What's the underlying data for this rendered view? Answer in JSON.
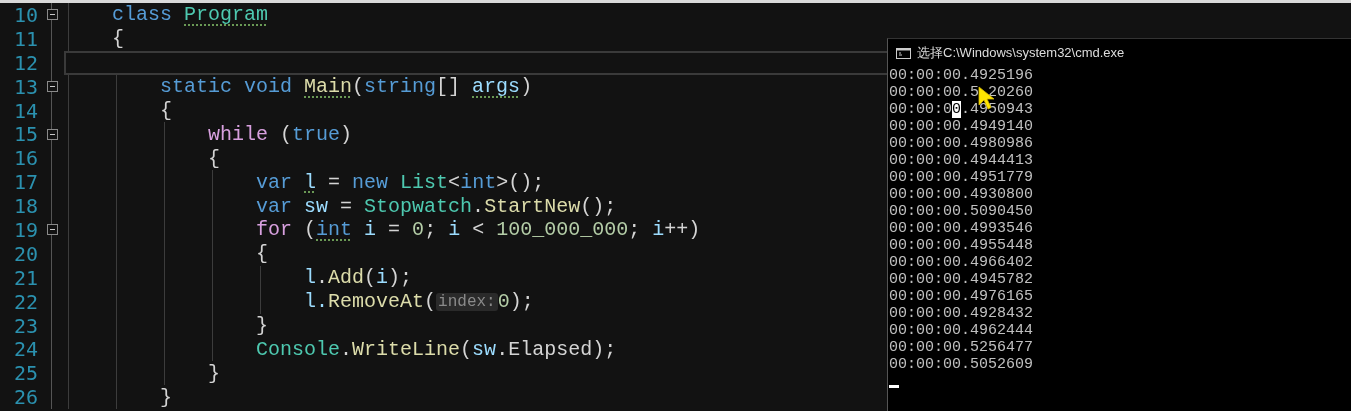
{
  "editor": {
    "lines": [
      {
        "number": "10",
        "current": false,
        "expanded": true,
        "tokens": [
          {
            "text": "    class ",
            "kind": "keyword"
          },
          {
            "text": "Program",
            "kind": "type",
            "underline": true
          }
        ]
      },
      {
        "number": "11",
        "current": false,
        "tokens": [
          {
            "text": "    {",
            "kind": "plain"
          }
        ]
      },
      {
        "number": "12",
        "current": true
      },
      {
        "number": "13",
        "current": false,
        "expanded": true,
        "tokens": [
          {
            "text": "        static void ",
            "kind": "keyword"
          },
          {
            "text": "Main",
            "kind": "method",
            "underline": true
          },
          {
            "text": "(",
            "kind": "plain"
          },
          {
            "text": "string",
            "kind": "keyword"
          },
          {
            "text": "[] ",
            "kind": "plain"
          },
          {
            "text": "args",
            "kind": "local",
            "underline": true
          },
          {
            "text": ")",
            "kind": "plain"
          }
        ]
      },
      {
        "number": "14",
        "current": false,
        "tokens": [
          {
            "text": "        {",
            "kind": "plain"
          }
        ]
      },
      {
        "number": "15",
        "current": false,
        "expanded": true,
        "tokens": [
          {
            "text": "            while",
            "kind": "control"
          },
          {
            "text": " (",
            "kind": "plain"
          },
          {
            "text": "true",
            "kind": "keyword"
          },
          {
            "text": ")",
            "kind": "plain"
          }
        ]
      },
      {
        "number": "16",
        "current": false,
        "tokens": [
          {
            "text": "            {",
            "kind": "plain"
          }
        ]
      },
      {
        "number": "17",
        "current": false,
        "tokens": [
          {
            "text": "                var ",
            "kind": "keyword"
          },
          {
            "text": "l",
            "kind": "local",
            "underline": true
          },
          {
            "text": " = ",
            "kind": "plain"
          },
          {
            "text": "new ",
            "kind": "keyword"
          },
          {
            "text": "List",
            "kind": "type"
          },
          {
            "text": "<",
            "kind": "plain"
          },
          {
            "text": "int",
            "kind": "keyword"
          },
          {
            "text": ">();",
            "kind": "plain"
          }
        ]
      },
      {
        "number": "18",
        "current": false,
        "tokens": [
          {
            "text": "                var ",
            "kind": "keyword"
          },
          {
            "text": "sw",
            "kind": "local"
          },
          {
            "text": " = ",
            "kind": "plain"
          },
          {
            "text": "Stopwatch",
            "kind": "type"
          },
          {
            "text": ".",
            "kind": "plain"
          },
          {
            "text": "StartNew",
            "kind": "method"
          },
          {
            "text": "();",
            "kind": "plain"
          }
        ]
      },
      {
        "number": "19",
        "current": false,
        "expanded": true,
        "tokens": [
          {
            "text": "                for",
            "kind": "control"
          },
          {
            "text": " (",
            "kind": "plain"
          },
          {
            "text": "int",
            "kind": "keyword",
            "underline": true
          },
          {
            "text": " i",
            "kind": "local"
          },
          {
            "text": " = ",
            "kind": "plain"
          },
          {
            "text": "0",
            "kind": "number"
          },
          {
            "text": "; ",
            "kind": "plain"
          },
          {
            "text": "i",
            "kind": "local"
          },
          {
            "text": " < ",
            "kind": "plain"
          },
          {
            "text": "100_000_000",
            "kind": "number"
          },
          {
            "text": "; ",
            "kind": "plain"
          },
          {
            "text": "i",
            "kind": "local"
          },
          {
            "text": "++)",
            "kind": "plain"
          }
        ]
      },
      {
        "number": "20",
        "current": false,
        "tokens": [
          {
            "text": "                {",
            "kind": "plain"
          }
        ]
      },
      {
        "number": "21",
        "current": false,
        "tokens": [
          {
            "text": "                    l",
            "kind": "local"
          },
          {
            "text": ".",
            "kind": "plain"
          },
          {
            "text": "Add",
            "kind": "method"
          },
          {
            "text": "(",
            "kind": "plain"
          },
          {
            "text": "i",
            "kind": "local"
          },
          {
            "text": ");",
            "kind": "plain"
          }
        ]
      },
      {
        "number": "22",
        "current": false,
        "tokens": [
          {
            "text": "                    l.",
            "kind": "local"
          },
          {
            "text": "RemoveAt",
            "kind": "method"
          },
          {
            "text": "(",
            "kind": "plain"
          },
          {
            "text": "index:",
            "kind": "hint"
          },
          {
            "text": "0",
            "kind": "number"
          },
          {
            "text": ");",
            "kind": "plain"
          }
        ]
      },
      {
        "number": "23",
        "current": false,
        "tokens": [
          {
            "text": "                }",
            "kind": "plain"
          }
        ]
      },
      {
        "number": "24",
        "current": false,
        "tokens": [
          {
            "text": "                Console",
            "kind": "type"
          },
          {
            "text": ".",
            "kind": "plain"
          },
          {
            "text": "WriteLine",
            "kind": "method"
          },
          {
            "text": "(",
            "kind": "plain"
          },
          {
            "text": "sw",
            "kind": "local"
          },
          {
            "text": ".",
            "kind": "plain"
          },
          {
            "text": "Elapsed",
            "kind": "plain"
          },
          {
            "text": ");",
            "kind": "plain"
          }
        ]
      },
      {
        "number": "25",
        "current": false,
        "tokens": [
          {
            "text": "            }",
            "kind": "plain"
          }
        ]
      },
      {
        "number": "26",
        "current": false,
        "tokens": [
          {
            "text": "        }",
            "kind": "plain"
          }
        ]
      }
    ]
  },
  "console": {
    "title": "选择C:\\Windows\\system32\\cmd.exe",
    "lines": [
      {
        "segments": [
          {
            "text": "00:00:00.4925196",
            "selected": false
          }
        ]
      },
      {
        "cursor_over": true,
        "segments": [
          {
            "text": "00:00:00.5",
            "selected": false
          },
          {
            "text": "20260",
            "selected": false
          }
        ]
      },
      {
        "segments": [
          {
            "text": "00:00:0",
            "selected": false
          },
          {
            "text": "0",
            "selected": true
          },
          {
            "text": ".4950943",
            "selected": false
          }
        ]
      },
      {
        "segments": [
          {
            "text": "00:00:00.4949140",
            "selected": false
          }
        ]
      },
      {
        "segments": [
          {
            "text": "00:00:00.4980986",
            "selected": false
          }
        ]
      },
      {
        "segments": [
          {
            "text": "00:00:00.4944413",
            "selected": false
          }
        ]
      },
      {
        "segments": [
          {
            "text": "00:00:00.4951779",
            "selected": false
          }
        ]
      },
      {
        "segments": [
          {
            "text": "00:00:00.4930800",
            "selected": false
          }
        ]
      },
      {
        "segments": [
          {
            "text": "00:00:00.5090450",
            "selected": false
          }
        ]
      },
      {
        "segments": [
          {
            "text": "00:00:00.4993546",
            "selected": false
          }
        ]
      },
      {
        "segments": [
          {
            "text": "00:00:00.4955448",
            "selected": false
          }
        ]
      },
      {
        "segments": [
          {
            "text": "00:00:00.4966402",
            "selected": false
          }
        ]
      },
      {
        "segments": [
          {
            "text": "00:00:00.4945782",
            "selected": false
          }
        ]
      },
      {
        "segments": [
          {
            "text": "00:00:00.4976165",
            "selected": false
          }
        ]
      },
      {
        "segments": [
          {
            "text": "00:00:00.4928432",
            "selected": false
          }
        ]
      },
      {
        "segments": [
          {
            "text": "00:00:00.4962444",
            "selected": false
          }
        ]
      },
      {
        "segments": [
          {
            "text": "00:00:00.5256477",
            "selected": false
          }
        ]
      },
      {
        "segments": [
          {
            "text": "00:00:00.5052609",
            "selected": false
          }
        ]
      }
    ]
  }
}
